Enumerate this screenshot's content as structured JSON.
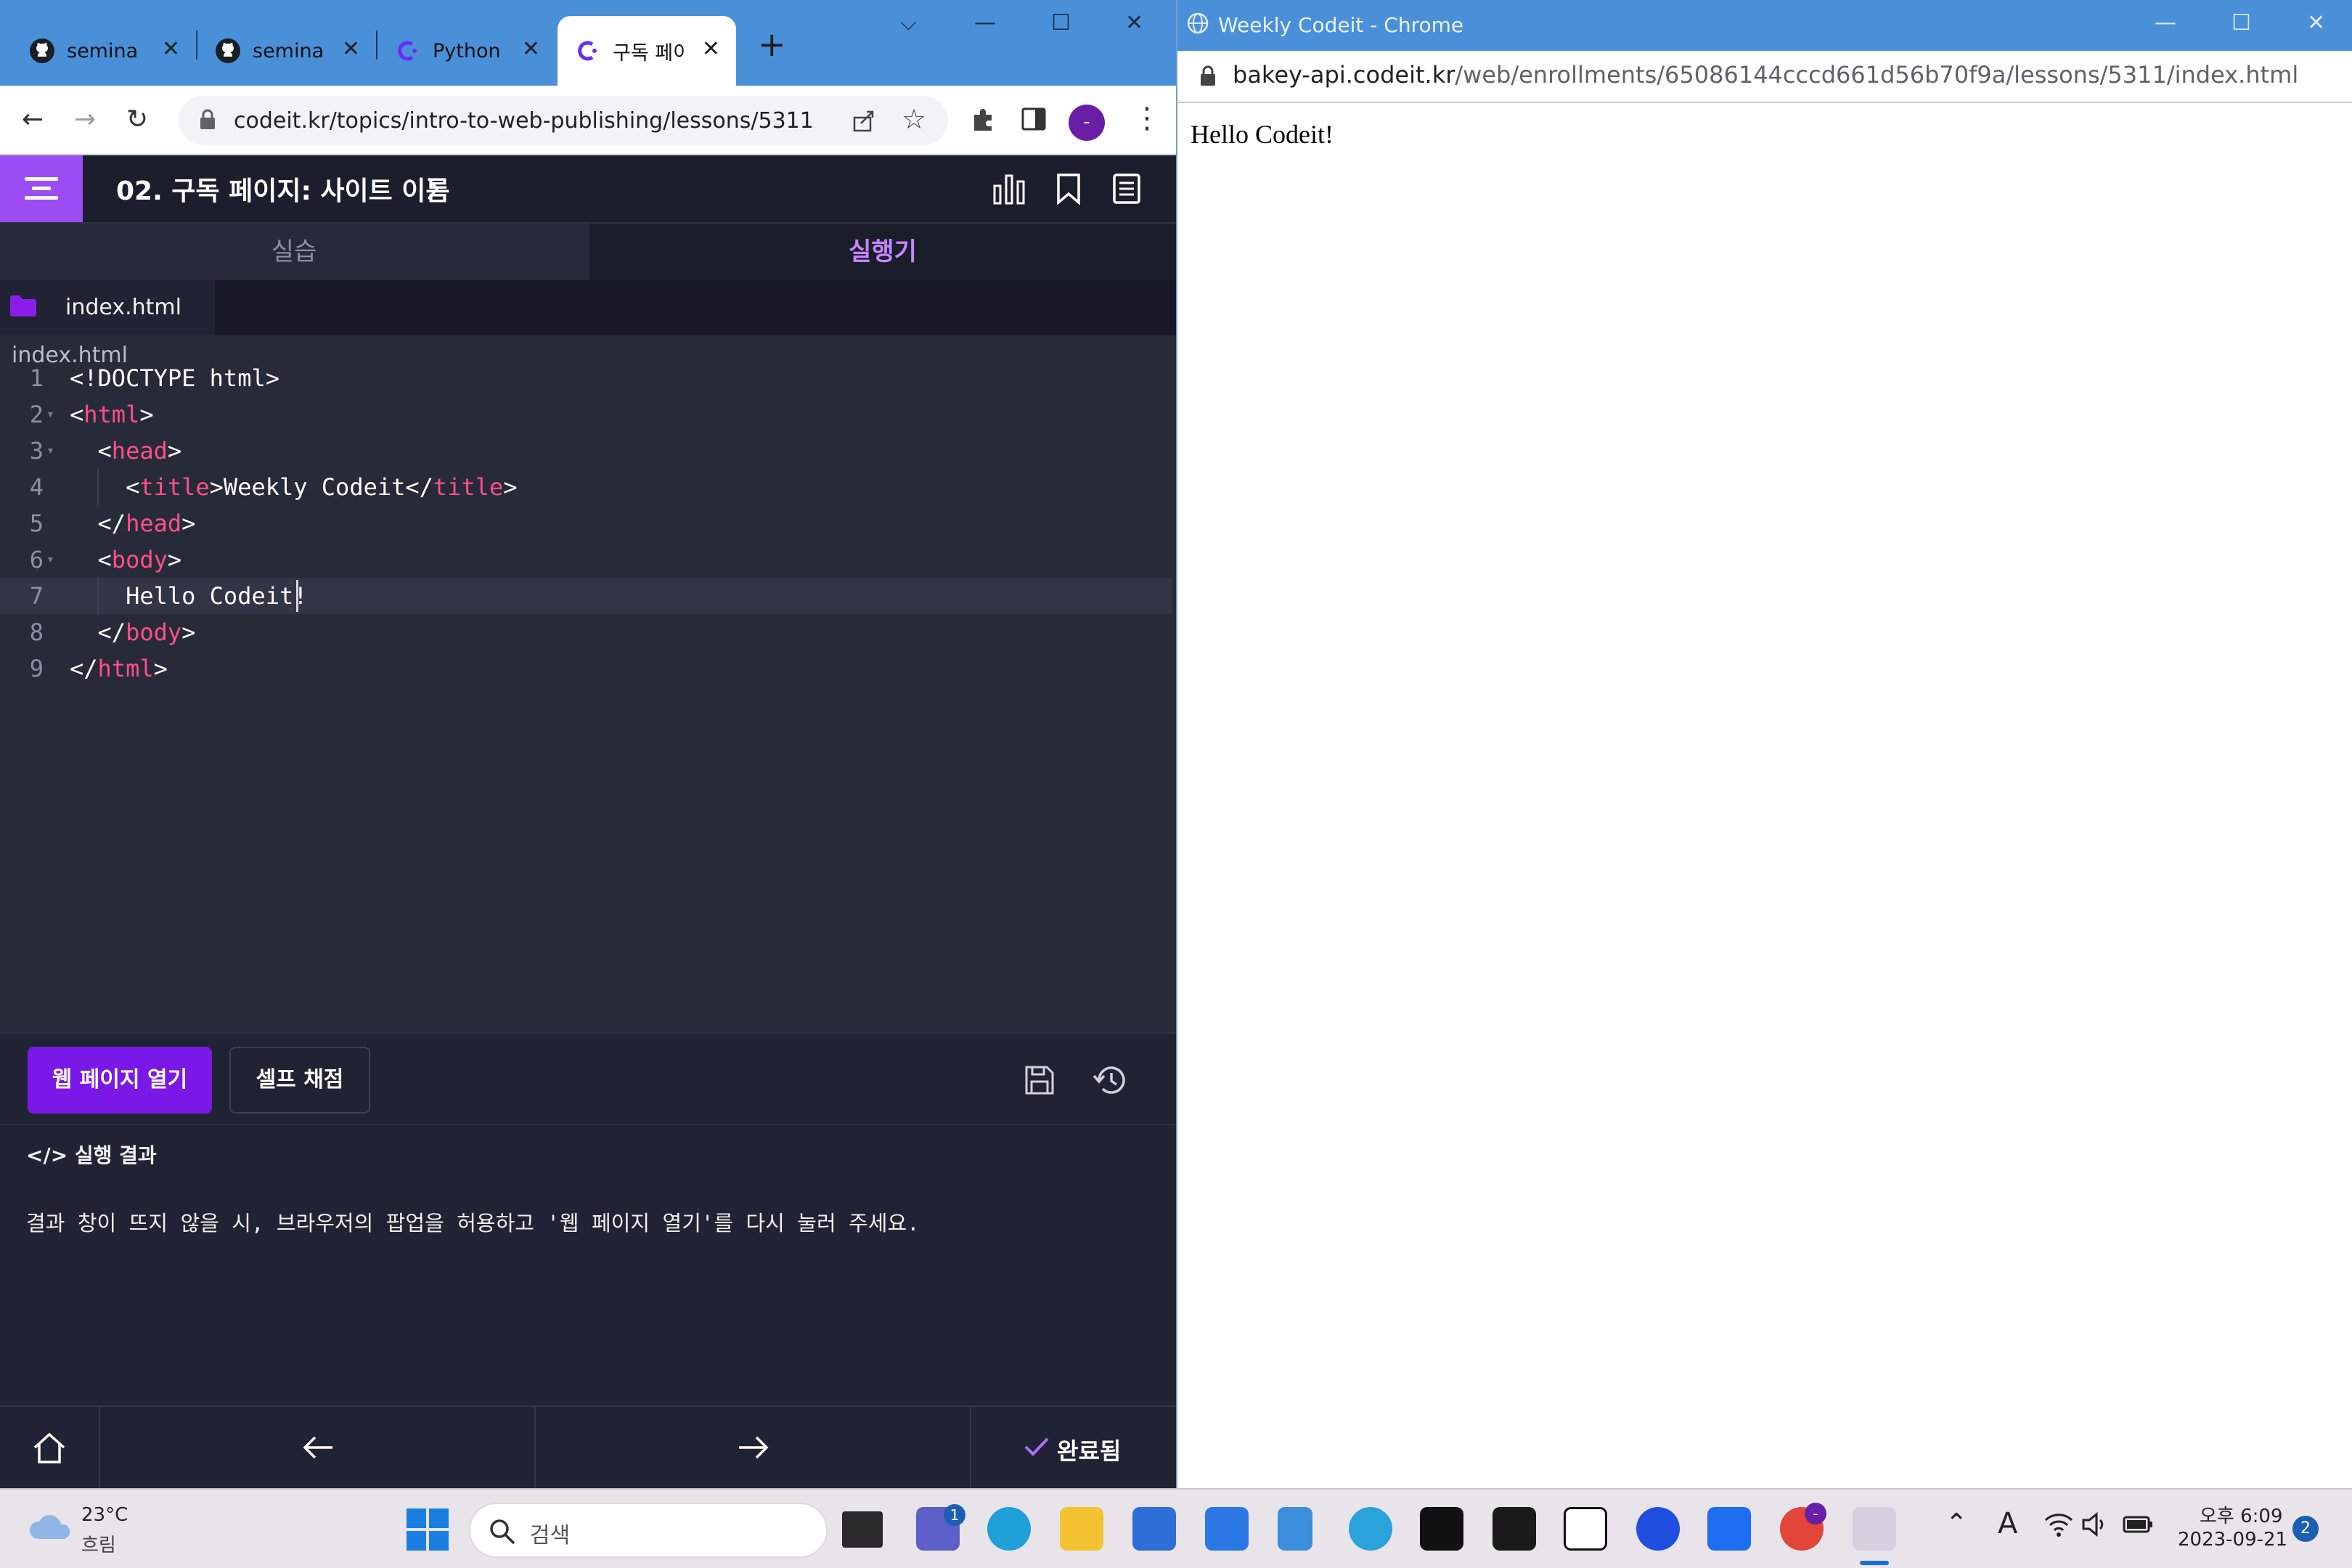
{
  "left_browser": {
    "tabs": [
      {
        "label": "seminar",
        "icon": "github-icon",
        "active": false
      },
      {
        "label": "seminar",
        "icon": "github-icon",
        "active": false
      },
      {
        "label": "Python",
        "icon": "codeit-icon",
        "active": false
      },
      {
        "label": "구독 페이",
        "icon": "codeit-icon",
        "active": true
      }
    ],
    "url": "codeit.kr/topics/intro-to-web-publishing/lessons/5311",
    "profile_initial": "-"
  },
  "app": {
    "lesson_title": "02. 구독 페이지: 사이트 이름",
    "view_tabs": {
      "practice": "실습",
      "runner": "실행기"
    },
    "file_tab": "index.html",
    "editor_filename": "index.html",
    "code_lines": [
      {
        "n": "1",
        "text": "<!DOCTYPE html>"
      },
      {
        "n": "2",
        "text": "<html>"
      },
      {
        "n": "3",
        "text": "  <head>"
      },
      {
        "n": "4",
        "text": "    <title>Weekly Codeit</title>"
      },
      {
        "n": "5",
        "text": "  </head>"
      },
      {
        "n": "6",
        "text": "  <body>"
      },
      {
        "n": "7",
        "text": "    Hello Codeit!"
      },
      {
        "n": "8",
        "text": "  </body>"
      },
      {
        "n": "9",
        "text": "</html>"
      }
    ],
    "open_web_button": "웹 페이지 열기",
    "self_grade_button": "셀프 채점",
    "result_heading": "</> 실행 결과",
    "result_text": "결과 창이 뜨지 않을 시, 브라우저의 팝업을 허용하고 '웹 페이지 열기'를 다시 눌러 주세요.",
    "done_label": "완료됨"
  },
  "right_browser": {
    "title": "Weekly Codeit - Chrome",
    "url_host": "bakey-api.codeit.kr",
    "url_path": "/web/enrollments/65086144cccd661d56b70f9a/lessons/5311/index.html",
    "page_text": "Hello Codeit!"
  },
  "taskbar": {
    "weather_temp": "23°C",
    "weather_cond": "흐림",
    "search_placeholder": "검색",
    "chat_badge": "1",
    "chrome_badge": "-",
    "ime_label": "A",
    "clock_time": "오후 6:09",
    "clock_date": "2023-09-21",
    "notification_count": "2"
  },
  "colors": {
    "accent_purple": "#7a18e8",
    "menu_purple": "#9b4cf2",
    "tag_pink": "#ff4f8a",
    "titlebar_blue": "#4a90d9"
  }
}
